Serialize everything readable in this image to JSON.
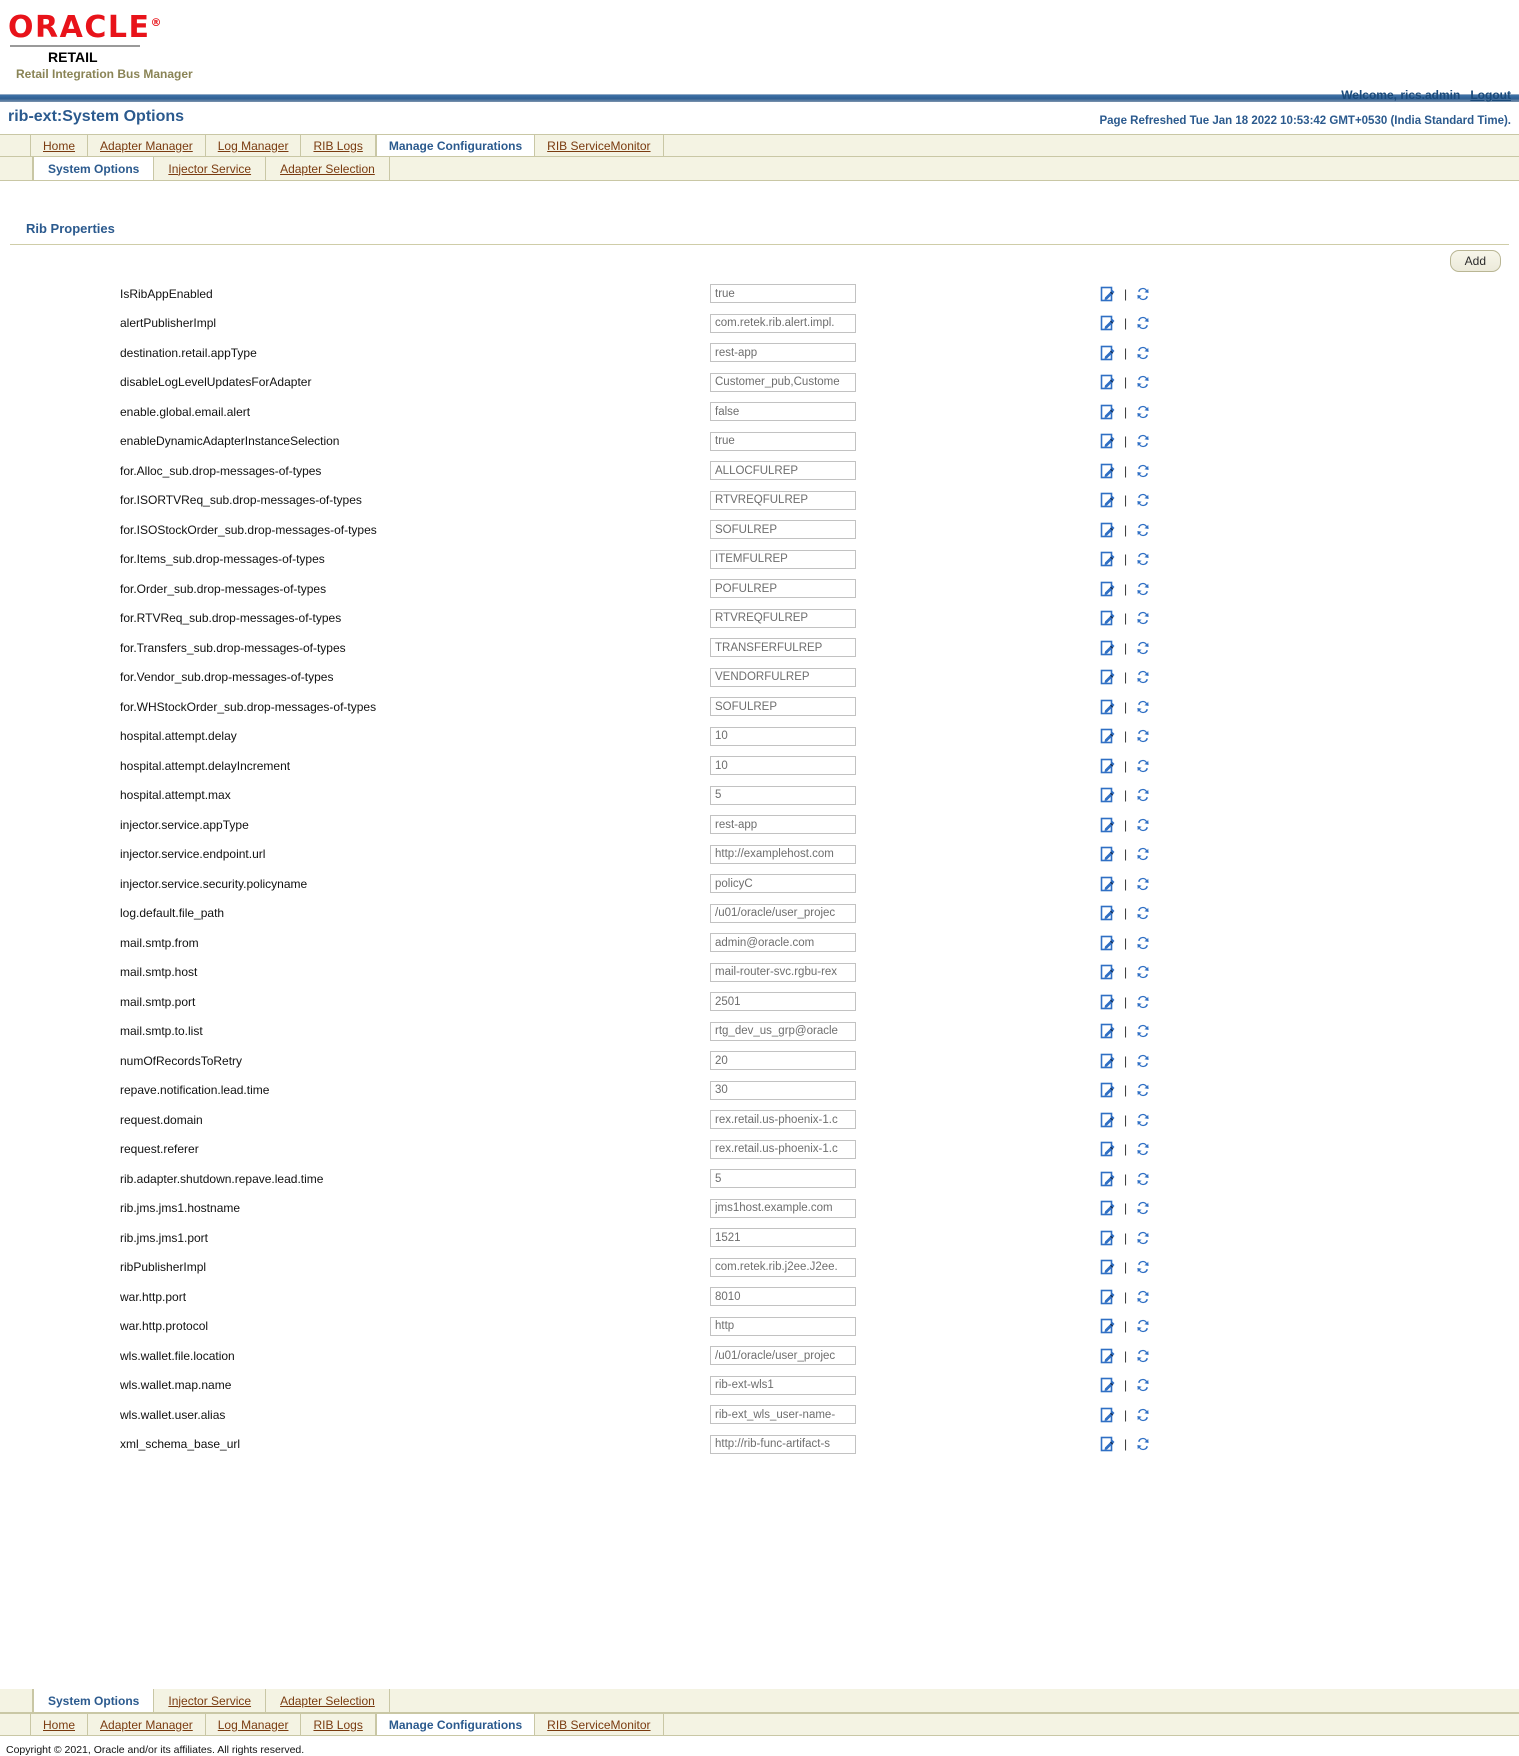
{
  "branding": {
    "oracle": "ORACLE",
    "registered": "®",
    "retail": "RETAIL",
    "app_name": "Retail Integration Bus Manager"
  },
  "header": {
    "welcome": "Welcome, rics.admin",
    "logout": "Logout",
    "page_title": "rib-ext:System Options",
    "refresh_note": "Page Refreshed Tue Jan 18 2022 10:53:42 GMT+0530 (India Standard Time)."
  },
  "main_tabs": [
    {
      "label": "Home",
      "active": false
    },
    {
      "label": "Adapter Manager",
      "active": false
    },
    {
      "label": "Log Manager",
      "active": false
    },
    {
      "label": "RIB Logs",
      "active": false
    },
    {
      "label": "Manage Configurations",
      "active": true
    },
    {
      "label": "RIB ServiceMonitor",
      "active": false
    }
  ],
  "sub_tabs": [
    {
      "label": "System Options",
      "active": true
    },
    {
      "label": "Injector Service",
      "active": false
    },
    {
      "label": "Adapter Selection",
      "active": false
    }
  ],
  "section": {
    "title": "Rib Properties",
    "add_label": "Add",
    "edit_icon": "edit-icon",
    "refresh_icon": "refresh-icon"
  },
  "properties": [
    {
      "name": "IsRibAppEnabled",
      "value": "true"
    },
    {
      "name": "alertPublisherImpl",
      "value": "com.retek.rib.alert.impl."
    },
    {
      "name": "destination.retail.appType",
      "value": "rest-app"
    },
    {
      "name": "disableLogLevelUpdatesForAdapter",
      "value": "Customer_pub,Custome"
    },
    {
      "name": "enable.global.email.alert",
      "value": "false"
    },
    {
      "name": "enableDynamicAdapterInstanceSelection",
      "value": "true"
    },
    {
      "name": "for.Alloc_sub.drop-messages-of-types",
      "value": "ALLOCFULREP"
    },
    {
      "name": "for.ISORTVReq_sub.drop-messages-of-types",
      "value": "RTVREQFULREP"
    },
    {
      "name": "for.ISOStockOrder_sub.drop-messages-of-types",
      "value": "SOFULREP"
    },
    {
      "name": "for.Items_sub.drop-messages-of-types",
      "value": "ITEMFULREP"
    },
    {
      "name": "for.Order_sub.drop-messages-of-types",
      "value": "POFULREP"
    },
    {
      "name": "for.RTVReq_sub.drop-messages-of-types",
      "value": "RTVREQFULREP"
    },
    {
      "name": "for.Transfers_sub.drop-messages-of-types",
      "value": "TRANSFERFULREP"
    },
    {
      "name": "for.Vendor_sub.drop-messages-of-types",
      "value": "VENDORFULREP"
    },
    {
      "name": "for.WHStockOrder_sub.drop-messages-of-types",
      "value": "SOFULREP"
    },
    {
      "name": "hospital.attempt.delay",
      "value": "10"
    },
    {
      "name": "hospital.attempt.delayIncrement",
      "value": "10"
    },
    {
      "name": "hospital.attempt.max",
      "value": "5"
    },
    {
      "name": "injector.service.appType",
      "value": "rest-app"
    },
    {
      "name": "injector.service.endpoint.url",
      "value": "http://examplehost.com"
    },
    {
      "name": "injector.service.security.policyname",
      "value": "policyC"
    },
    {
      "name": "log.default.file_path",
      "value": "/u01/oracle/user_projec"
    },
    {
      "name": "mail.smtp.from",
      "value": "admin@oracle.com"
    },
    {
      "name": "mail.smtp.host",
      "value": "mail-router-svc.rgbu-rex"
    },
    {
      "name": "mail.smtp.port",
      "value": "2501"
    },
    {
      "name": "mail.smtp.to.list",
      "value": "rtg_dev_us_grp@oracle"
    },
    {
      "name": "numOfRecordsToRetry",
      "value": "20"
    },
    {
      "name": "repave.notification.lead.time",
      "value": "30"
    },
    {
      "name": "request.domain",
      "value": "rex.retail.us-phoenix-1.c"
    },
    {
      "name": "request.referer",
      "value": "rex.retail.us-phoenix-1.c"
    },
    {
      "name": "rib.adapter.shutdown.repave.lead.time",
      "value": "5"
    },
    {
      "name": "rib.jms.jms1.hostname",
      "value": "jms1host.example.com"
    },
    {
      "name": "rib.jms.jms1.port",
      "value": "1521"
    },
    {
      "name": "ribPublisherImpl",
      "value": "com.retek.rib.j2ee.J2ee."
    },
    {
      "name": "war.http.port",
      "value": "8010"
    },
    {
      "name": "war.http.protocol",
      "value": "http"
    },
    {
      "name": "wls.wallet.file.location",
      "value": "/u01/oracle/user_projec"
    },
    {
      "name": "wls.wallet.map.name",
      "value": "rib-ext-wls1"
    },
    {
      "name": "wls.wallet.user.alias",
      "value": "rib-ext_wls_user-name-"
    },
    {
      "name": "xml_schema_base_url",
      "value": "http://rib-func-artifact-s"
    }
  ],
  "footer": {
    "copyright": "Copyright © 2021, Oracle and/or its affiliates. All rights reserved."
  },
  "colors": {
    "oracle_red": "#e8131a",
    "title_blue": "#2b5a8e",
    "link_brown": "#7a3b10",
    "tab_cream": "#f4f3e3",
    "icon_blue": "#2f6fc4"
  }
}
